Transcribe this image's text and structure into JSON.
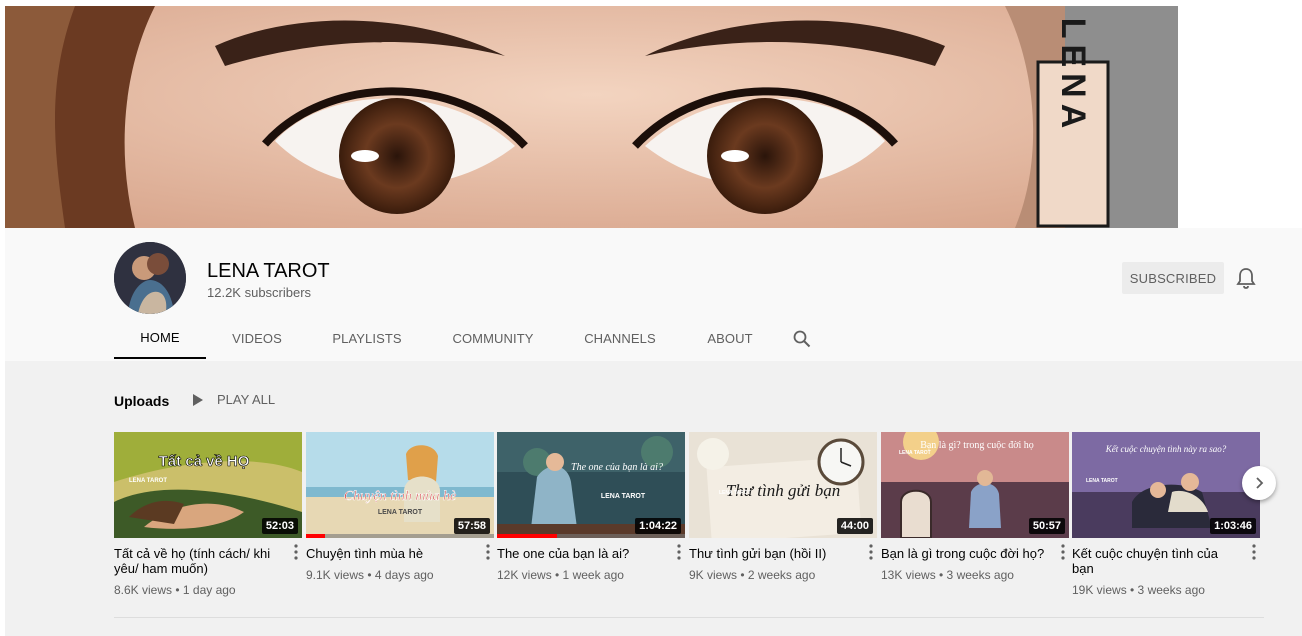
{
  "channel": {
    "name": "LENA TAROT",
    "subscribers": "12.2K subscribers",
    "subscribe_label": "SUBSCRIBED",
    "banner_text": "LENA"
  },
  "tabs": [
    {
      "label": "HOME",
      "active": true
    },
    {
      "label": "VIDEOS"
    },
    {
      "label": "PLAYLISTS"
    },
    {
      "label": "COMMUNITY"
    },
    {
      "label": "CHANNELS"
    },
    {
      "label": "ABOUT"
    }
  ],
  "shelf": {
    "title": "Uploads",
    "play_all": "PLAY ALL"
  },
  "videos": [
    {
      "title": "Tất cả về họ (tính cách/ khi yêu/ ham muốn)",
      "meta": "8.6K views • 1 day ago",
      "duration": "52:03",
      "thumb_text": "Tất cả về HỌ"
    },
    {
      "title": "Chuyện tình mùa hè",
      "meta": "9.1K views • 4 days ago",
      "duration": "57:58",
      "thumb_text": "Chuyện tình mùa hè",
      "progress": 0.1
    },
    {
      "title": "The one của bạn là ai?",
      "meta": "12K views • 1 week ago",
      "duration": "1:04:22",
      "thumb_text": "The one của bạn là ai?",
      "progress": 0.32
    },
    {
      "title": "Thư tình gửi bạn (hồi II)",
      "meta": "9K views • 2 weeks ago",
      "duration": "44:00",
      "thumb_text": "Thư tình gửi bạn"
    },
    {
      "title": "Bạn là gì trong cuộc đời họ?",
      "meta": "13K views • 3 weeks ago",
      "duration": "50:57",
      "thumb_text": "Bạn là gì? trong cuộc đời họ"
    },
    {
      "title": "Kết cuộc chuyện tình của bạn",
      "meta": "19K views • 3 weeks ago",
      "duration": "1:03:46",
      "thumb_text": "Kết cuộc chuyện tình này ra sao?"
    }
  ],
  "thumb_brand": "LENA TAROT",
  "colors": {
    "accent": "#ff0000",
    "text_primary": "#030303",
    "text_secondary": "#606060",
    "header_bg": "#f9f9f9",
    "shelf_bg": "#f1f1f1"
  },
  "icons": {
    "bell": "bell-icon",
    "search": "search-icon",
    "play": "play-icon",
    "next": "chevron-right-icon",
    "more": "more-vert-icon"
  }
}
